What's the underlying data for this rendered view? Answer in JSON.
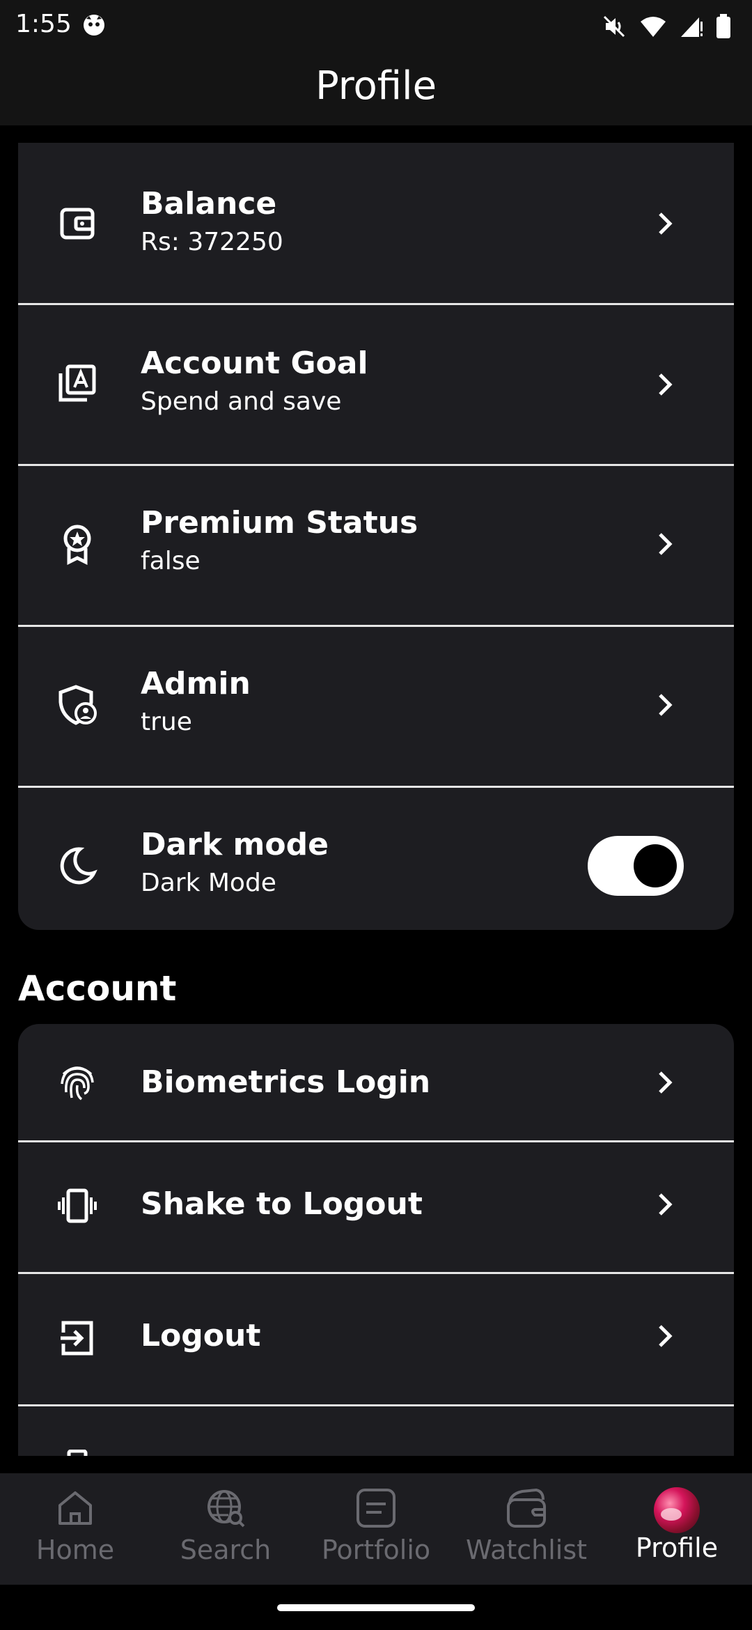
{
  "status_bar": {
    "time": "1:55"
  },
  "app_bar": {
    "title": "Profile"
  },
  "profile_items": [
    {
      "title": "Balance",
      "subtitle": "Rs: 372250",
      "icon": "wallet-icon"
    },
    {
      "title": "Account Goal",
      "subtitle": "Spend and save",
      "icon": "account-box-icon"
    },
    {
      "title": "Premium Status",
      "subtitle": "false",
      "icon": "award-icon"
    },
    {
      "title": "Admin",
      "subtitle": "true",
      "icon": "admin-shield-icon"
    },
    {
      "title": "Dark mode",
      "subtitle": "Dark Mode",
      "icon": "moon-icon",
      "toggle_on": true
    }
  ],
  "account_section": {
    "title": "Account",
    "items": [
      {
        "title": "Biometrics Login",
        "icon": "fingerprint-icon"
      },
      {
        "title": "Shake to Logout",
        "icon": "vibrate-icon"
      },
      {
        "title": "Logout",
        "icon": "logout-icon"
      }
    ]
  },
  "bottom_nav": [
    {
      "label": "Home",
      "icon": "home-icon"
    },
    {
      "label": "Search",
      "icon": "globe-search-icon"
    },
    {
      "label": "Portfolio",
      "icon": "portfolio-icon"
    },
    {
      "label": "Watchlist",
      "icon": "watchlist-icon"
    },
    {
      "label": "Profile",
      "icon": "avatar",
      "active": true
    }
  ],
  "colors": {
    "background": "#000000",
    "card": "#1d1d21",
    "bar": "#141414",
    "inactive_nav": "#6a6a70",
    "divider": "#e6e6e6"
  }
}
